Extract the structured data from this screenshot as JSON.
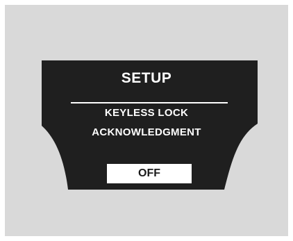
{
  "screen": {
    "title": "SETUP",
    "message_line1": "KEYLESS LOCK",
    "message_line2": "ACKNOWLEDGMENT",
    "selected_option": "OFF"
  },
  "colors": {
    "panel_background": "#d9d9d9",
    "display_background": "#1f1f1f",
    "text": "#ffffff",
    "option_background": "#ffffff",
    "option_text": "#1a1a1a"
  }
}
